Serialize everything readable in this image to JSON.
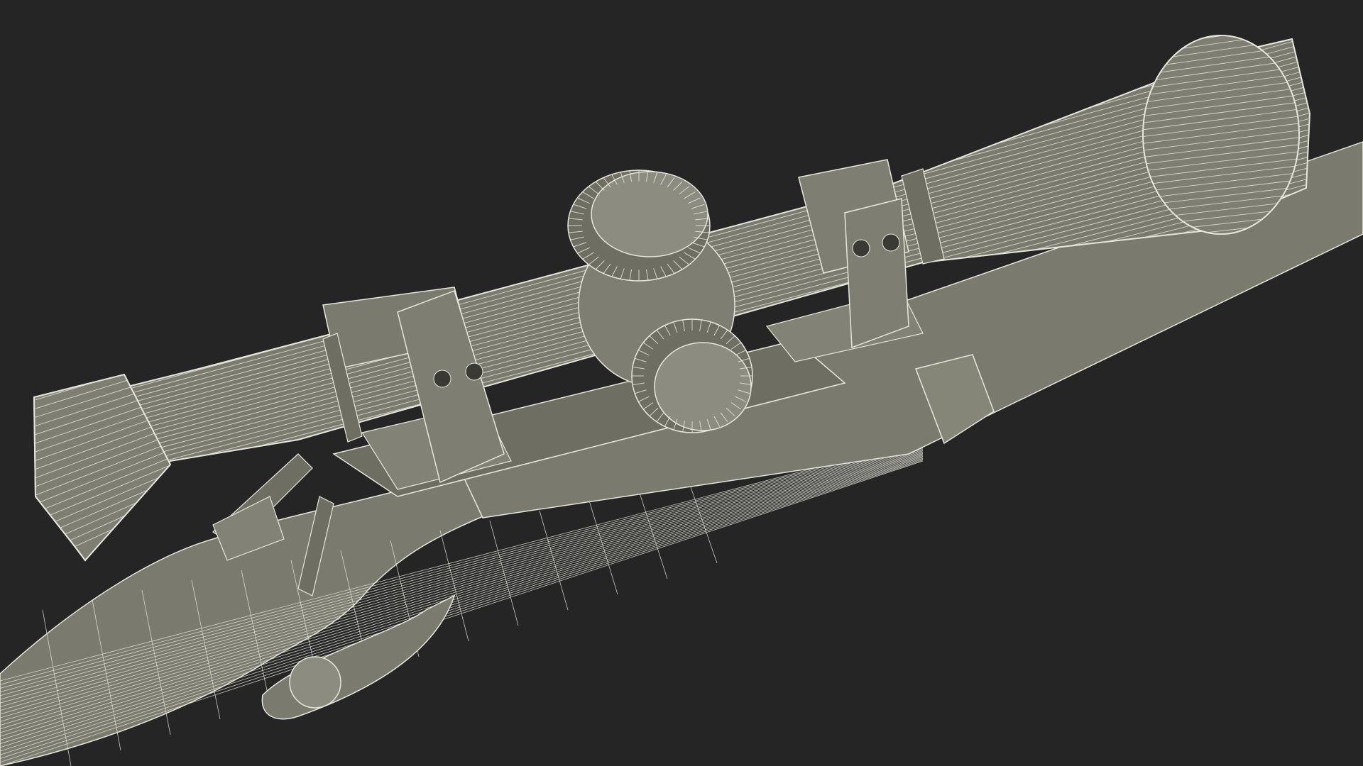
{
  "scene": {
    "subject": "rifle-with-scope-wireframe",
    "background_color": "#252525",
    "surface_color": "#7a7a6e",
    "surface_dark_color": "#5e5e54",
    "surface_light_color": "#8c8c80",
    "wire_color": "#e6e6dc"
  }
}
